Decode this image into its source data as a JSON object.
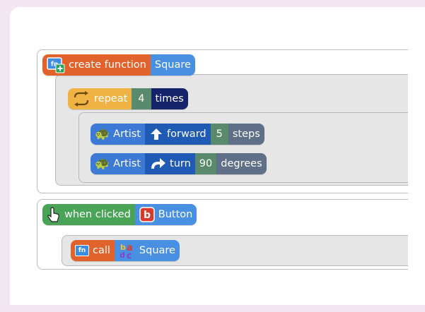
{
  "blocks": {
    "create_function": {
      "label": "create function",
      "name": "Square"
    },
    "repeat": {
      "label": "repeat",
      "count": "4",
      "unit": "times"
    },
    "forward": {
      "actor": "Artist",
      "verb": "forward",
      "value": "5",
      "unit": "steps"
    },
    "turn": {
      "actor": "Artist",
      "verb": "turn",
      "value": "90",
      "unit": "degrees"
    },
    "when_clicked": {
      "label": "when clicked",
      "button_letter": "b",
      "button_label": "Button"
    },
    "call": {
      "fn_icon": "fn",
      "label": "call",
      "name": "Square"
    }
  },
  "icons": {
    "function": "fn-plus-icon",
    "repeat": "repeat-arrows-icon",
    "artist": "turtle-icon",
    "forward": "arrow-up-icon",
    "turn": "turn-right-arrow-icon",
    "pointer": "pointer-hand-icon",
    "button": "b-button-icon",
    "variable": "abcd-letters-icon"
  },
  "colors": {
    "background": "#f1e6f2",
    "function_orange": "#e1622b",
    "name_blue": "#4a90e2",
    "repeat_orange": "#f0b244",
    "number_green": "#5a8a6d",
    "dark_navy": "#15236a",
    "artist_blue": "#3d7ad6",
    "step_slate": "#5f6f87",
    "event_green": "#4aa457"
  }
}
